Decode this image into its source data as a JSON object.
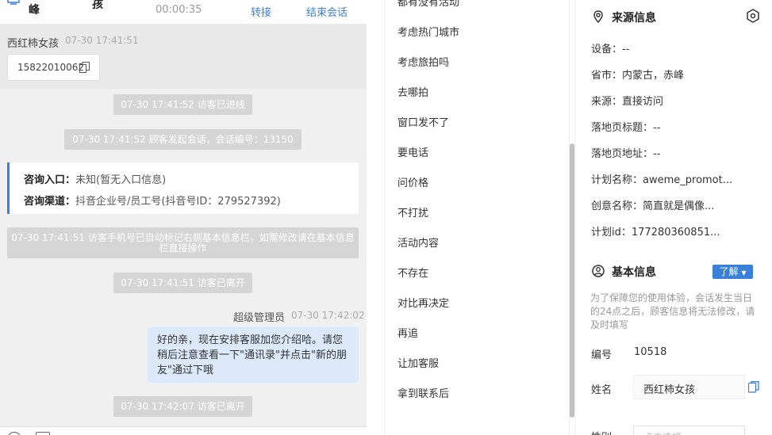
{
  "chat": {
    "header": {
      "visitor_line1": "峰",
      "visitor_line2": "孩",
      "duration": "00:00:35",
      "transfer_label": "转接",
      "end_label": "结束会话"
    },
    "visitor_message": {
      "name": "西红柿女孩",
      "time": "07-30 17:41:51",
      "phone": "15822010062"
    },
    "system_messages": [
      "07-30 17:41:52 访客已进线",
      "07-30 17:41:52 顾客发起会话，会话编号：13150",
      "07-30 17:41:51 访客手机号已自动标记右侧基本信息栏，如需修改请在基本信息栏直接操作",
      "07-30 17:41:51 访客已离开",
      "07-30 17:42:07 访客已离开"
    ],
    "inquiry": {
      "entry_label": "咨询入口：",
      "entry_value": "未知(暂无入口信息)",
      "channel_label": "咨询渠道：",
      "channel_value": "抖音企业号/员工号(抖音号ID：279527392)"
    },
    "agent_message": {
      "name": "超级管理员",
      "time": "07-30 17:42:02",
      "text": "好的亲，现在安排客服加您介绍哈。请您稍后注意查看一下\"通讯录\"并点击\"新的朋友\"通过下哦"
    }
  },
  "quick_replies": [
    "都有没有活动",
    "考虑热门城市",
    "考虑旅拍吗",
    "去哪拍",
    "窗口发不了",
    "要电话",
    "问价格",
    "不打扰",
    "活动内容",
    "不存在",
    "对比再决定",
    "再追",
    "让加客服",
    "拿到联系后"
  ],
  "info": {
    "source_title": "来源信息",
    "source_rows": [
      "设备：--",
      "省市：内蒙古，赤峰",
      "来源：直接访问",
      "落地页标题：--",
      "落地页地址：--",
      "计划名称：aweme_promot...",
      "创意名称：简直就是偶像...",
      "计划id：177280360851..."
    ],
    "basic_title": "基本信息",
    "learn_label": "了解",
    "notice": "为了保障您的使用体验，会话发生当日的24点之后，顾客信息将无法修改，请及时填写",
    "id_label": "编号",
    "id_value": "10518",
    "name_label": "姓名",
    "name_value": "西红柿女孩",
    "gender_label": "性别",
    "gender_placeholder": "点击选择"
  },
  "colors": {
    "accent": "#3a7fd8",
    "system_bubble": "#d5d5d5",
    "agent_bubble": "#dce9fb"
  }
}
